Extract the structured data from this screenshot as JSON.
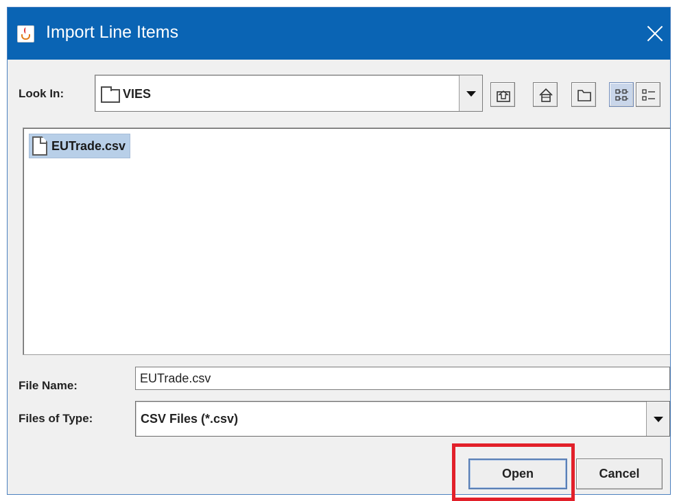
{
  "dialog": {
    "title": "Import Line Items",
    "icons": {
      "app": "java-cup-icon",
      "close": "close-icon"
    }
  },
  "look_in": {
    "label": "Look In:",
    "value": "VIES",
    "icon": "folder-icon"
  },
  "toolbar": {
    "buttons": [
      {
        "name": "up-one-level-button",
        "icon": "up-folder-icon"
      },
      {
        "name": "home-button",
        "icon": "home-icon"
      },
      {
        "name": "new-folder-button",
        "icon": "new-folder-icon"
      },
      {
        "name": "list-view-button",
        "icon": "list-view-icon",
        "selected": true
      },
      {
        "name": "details-view-button",
        "icon": "details-view-icon",
        "selected": false
      }
    ]
  },
  "files": [
    {
      "name": "EUTrade.csv",
      "icon": "file-icon",
      "selected": true
    }
  ],
  "file_name": {
    "label": "File Name:",
    "value": "EUTrade.csv"
  },
  "files_of_type": {
    "label": "Files of Type:",
    "value": "CSV Files (*.csv)"
  },
  "buttons": {
    "open": "Open",
    "cancel": "Cancel"
  },
  "colors": {
    "titlebar": "#0a64b4",
    "highlight": "#e2202a",
    "selection": "#b8cfe8"
  }
}
